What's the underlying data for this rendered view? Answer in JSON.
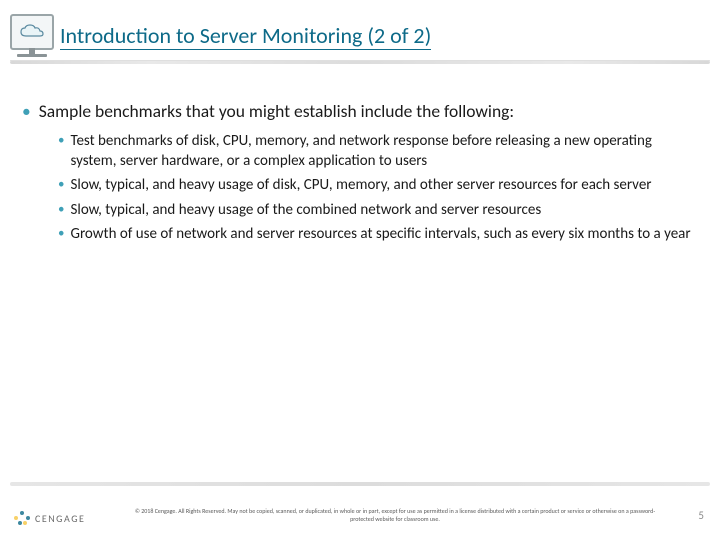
{
  "header": {
    "title": "Introduction to Server Monitoring (2 of 2)"
  },
  "body": {
    "lead": "Sample benchmarks that you might establish include the following:",
    "items": [
      "Test benchmarks of disk, CPU, memory, and network response before releasing a new operating system, server hardware, or a complex application to users",
      "Slow, typical, and heavy usage of disk, CPU, memory, and other server resources for each server",
      "Slow, typical, and heavy usage of the combined network and server resources",
      "Growth of use of network and server resources at specific intervals, such as every six months to a year"
    ]
  },
  "footer": {
    "brand": "CENGAGE",
    "copyright": "© 2018 Cengage. All Rights Reserved. May not be copied, scanned, or duplicated, in whole or in part, except for use as permitted in a license distributed with a certain product or service or otherwise on a password-protected website for classroom use.",
    "page": "5"
  }
}
